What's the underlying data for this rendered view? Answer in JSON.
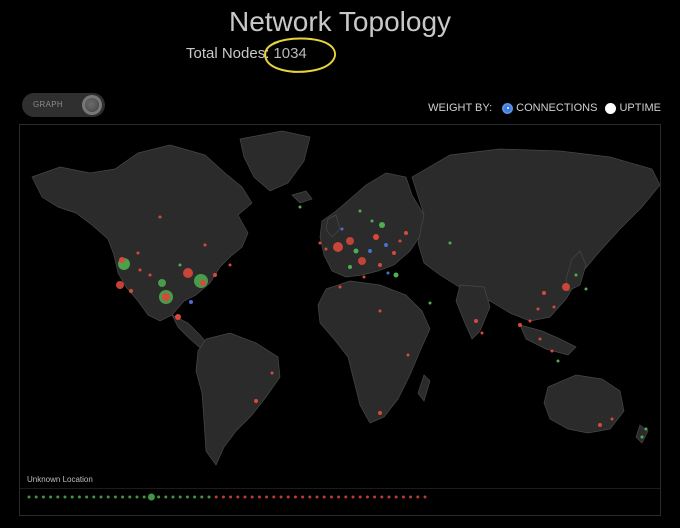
{
  "header": {
    "title": "Network Topology",
    "total_label": "Total Nodes:",
    "total_value": "1034"
  },
  "toggle": {
    "label": "GRAPH"
  },
  "weight_by": {
    "label": "WEIGHT BY:",
    "options": [
      {
        "label": "CONNECTIONS",
        "checked": true
      },
      {
        "label": "UPTIME",
        "checked": false
      }
    ]
  },
  "map": {
    "unknown_label": "Unknown Location"
  },
  "colors": {
    "green": "#4caf50",
    "red": "#d9483b",
    "blue": "#4a6fd1",
    "annotation": "#e8d43a",
    "land": "#2b2b2b",
    "border": "#444444"
  }
}
